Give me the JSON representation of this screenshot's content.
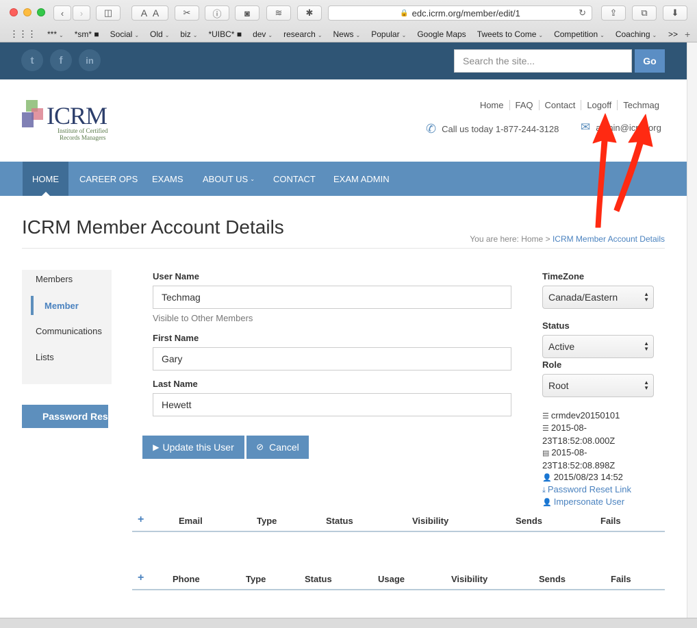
{
  "browser": {
    "url": "edc.icrm.org/member/edit/1",
    "bookmarks": [
      {
        "label": "***",
        "menu": true
      },
      {
        "label": "*sm* ■",
        "menu": false
      },
      {
        "label": "Social",
        "menu": true
      },
      {
        "label": "Old",
        "menu": true
      },
      {
        "label": "biz",
        "menu": true
      },
      {
        "label": "*UIBC* ■",
        "menu": false
      },
      {
        "label": "dev",
        "menu": true
      },
      {
        "label": "research",
        "menu": true
      },
      {
        "label": "News",
        "menu": true
      },
      {
        "label": "Popular",
        "menu": true
      },
      {
        "label": "Google Maps",
        "menu": false
      },
      {
        "label": "Tweets to Come",
        "menu": true
      },
      {
        "label": "Competition",
        "menu": true
      },
      {
        "label": "Coaching",
        "menu": true
      }
    ],
    "more": ">>"
  },
  "topbar": {
    "search_placeholder": "Search the site...",
    "go_label": "Go",
    "social": [
      "t",
      "f",
      "in"
    ]
  },
  "header": {
    "logo_word": "ICRM",
    "logo_sub_1": "Institute of Certified",
    "logo_sub_2": "Records Managers",
    "links": [
      "Home",
      "FAQ",
      "Contact",
      "Logoff",
      "Techmag"
    ],
    "phone": "Call us today 1-877-244-3128",
    "email": "admin@icrm.org"
  },
  "nav": [
    "HOME",
    "CAREER OPS",
    "EXAMS",
    "ABOUT US",
    "CONTACT",
    "EXAM ADMIN"
  ],
  "page": {
    "title": "ICRM Member Account Details",
    "crumb_prefix": "You are here:",
    "crumb_home": "Home",
    "crumb_sep": ">",
    "crumb_current": "ICRM Member Account Details"
  },
  "sidebar": {
    "items": [
      "Members",
      "Member",
      "Communications",
      "Lists"
    ],
    "password_button": "Password Reset"
  },
  "form": {
    "username_label": "User Name",
    "username_value": "Techmag",
    "username_hint": "Visible to Other Members",
    "firstname_label": "First Name",
    "firstname_value": "Gary",
    "lastname_label": "Last Name",
    "lastname_value": "Hewett",
    "update_label": "Update this User",
    "cancel_label": "Cancel"
  },
  "right": {
    "timezone_label": "TimeZone",
    "timezone_value": "Canada/Eastern",
    "status_label": "Status",
    "status_value": "Active",
    "role_label": "Role",
    "role_value": "Root",
    "db": "crmdev20150101",
    "created_1": "2015-08-",
    "created_2": "23T18:52:08.000Z",
    "updated_1": "2015-08-",
    "updated_2": "23T18:52:08.898Z",
    "login": "2015/08/23 14:52",
    "reset_link": "Password Reset Link",
    "impersonate": "Impersonate User"
  },
  "email_table": {
    "plus": "+",
    "cols": [
      "Email",
      "Type",
      "Status",
      "Visibility",
      "Sends",
      "Fails"
    ]
  },
  "phone_table": {
    "plus": "+",
    "cols": [
      "Phone",
      "Type",
      "Status",
      "Usage",
      "Visibility",
      "Sends",
      "Fails"
    ]
  },
  "colors": {
    "topbar": "#2f5575",
    "nav": "#5d8fbd",
    "accent": "#4a82bf",
    "arrow": "#ff2a12"
  }
}
